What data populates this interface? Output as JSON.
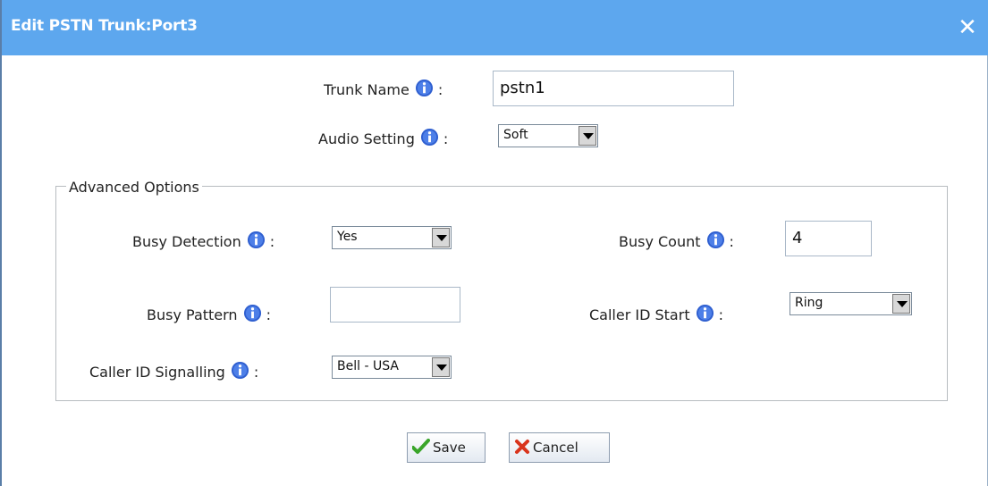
{
  "dialog": {
    "title": "Edit PSTN Trunk:Port3",
    "close_glyph": "✕"
  },
  "general": {
    "trunk_name": {
      "label": "Trunk Name",
      "value": "pstn1"
    },
    "audio_setting": {
      "label": "Audio Setting",
      "selected": "Soft"
    }
  },
  "advanced": {
    "legend": "Advanced Options",
    "busy_detection": {
      "label": "Busy Detection",
      "selected": "Yes"
    },
    "busy_count": {
      "label": "Busy Count",
      "value": "4"
    },
    "busy_pattern": {
      "label": "Busy Pattern",
      "value": ""
    },
    "caller_id_start": {
      "label": "Caller ID Start",
      "selected": "Ring"
    },
    "caller_id_signalling": {
      "label": "Caller ID Signalling",
      "selected": "Bell - USA"
    }
  },
  "buttons": {
    "save": "Save",
    "cancel": "Cancel"
  },
  "colors": {
    "titlebar": "#5da7ee",
    "info_icon": "#2f5fd0",
    "save_check": "#3aa52a",
    "cancel_x": "#d9341c"
  },
  "colon": ":"
}
